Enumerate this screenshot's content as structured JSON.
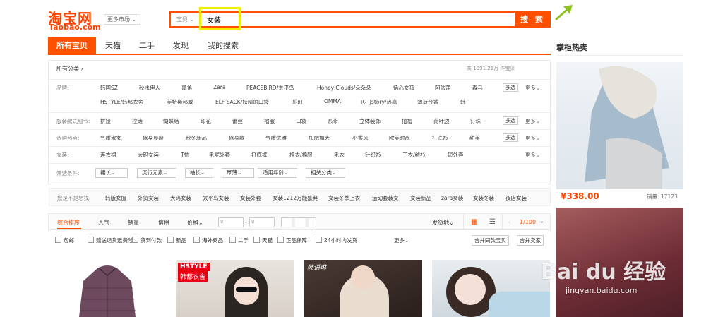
{
  "header": {
    "logo_cn": "淘宝网",
    "logo_en": "Taobao.com",
    "market": "更多市场"
  },
  "search": {
    "type": "宝贝",
    "query": "女装",
    "button": "搜 索"
  },
  "tabs": [
    "所有宝贝",
    "天猫",
    "二手",
    "发现",
    "我的搜索"
  ],
  "side": {
    "title": "掌柜热卖",
    "price": "¥338.00",
    "sold": "销量: 17123"
  },
  "filter": {
    "all_category": "所有分类",
    "count": "共 1891.21万 件宝贝",
    "multi": "多选",
    "more": "更多",
    "rows": [
      {
        "label": "品牌:",
        "items": [
          "韩国SZ",
          "秋水伊人",
          "哥弟",
          "Zara",
          "PEACEBIRD/太平鸟",
          "Honey Clouds/朵朵朵",
          "恬心女孩",
          "阿依莲",
          "森马"
        ],
        "items2": [
          "HSTYLE/韩都衣舍",
          "美特斯邦威",
          "ELF SACK/妖精的口袋",
          "乐町",
          "OMMA",
          "R。Jstory/热嘉",
          "薄荷合香",
          "韩"
        ]
      },
      {
        "label": "服装款式细节:",
        "items": [
          "拼接",
          "拉链",
          "蝴蝶结",
          "印花",
          "蕾丝",
          "褶皱",
          "口袋",
          "系带",
          "立体装饰",
          "抽褶",
          "荷叶边",
          "钉珠"
        ]
      },
      {
        "label": "选购热点:",
        "items": [
          "气质淑女",
          "修身显瘦",
          "秋冬新品",
          "修身款",
          "气质优雅",
          "加肥加大",
          "小香风",
          "欧美时尚",
          "打底衫",
          "甜美"
        ]
      },
      {
        "label": "女装:",
        "items": [
          "连衣裙",
          "大码女装",
          "T恤",
          "毛呢外套",
          "打底裤",
          "棉衣/棉服",
          "毛衣",
          "针织衫",
          "卫衣/绒衫",
          "短外套"
        ]
      }
    ],
    "conditions_label": "筛选条件:",
    "dropdowns": [
      "裙长",
      "流行元素",
      "袖长",
      "厚薄",
      "适用年龄",
      "相关分类"
    ]
  },
  "suggest": {
    "label": "您是不是想找:",
    "items": [
      "韩版女服",
      "外贸女装",
      "大码女装",
      "太平鸟女装",
      "女装外套",
      "女装1212万能盛典",
      "女装冬季上衣",
      "运动套装女",
      "女装新品",
      "zara女装",
      "女装冬装",
      "夜店女装"
    ]
  },
  "sortbar": {
    "items": [
      "综合排序",
      "人气",
      "销量",
      "信用",
      "价格"
    ],
    "price_from": "¥",
    "price_to": "¥",
    "ship": "发货地",
    "page": "1/100"
  },
  "options": {
    "items": [
      "包邮",
      "赠送退货运费险",
      "货到付款",
      "新品",
      "海外商品",
      "二手",
      "天猫",
      "正品保障",
      "24小时内发货"
    ],
    "more": "更多",
    "merge1": "合并同款宝贝",
    "merge2": "合并卖家"
  },
  "products": {
    "p2_badge1": "HSTYLE",
    "p2_badge2": "韩都衣舍",
    "p3_badge": "韩语琳"
  },
  "watermark": {
    "line1": "Bai du 经验",
    "line2": "jingyan.baidu.com"
  },
  "colors": {
    "accent": "#ff5000",
    "highlight": "#f0ee00",
    "arrow": "#8dc21f"
  }
}
